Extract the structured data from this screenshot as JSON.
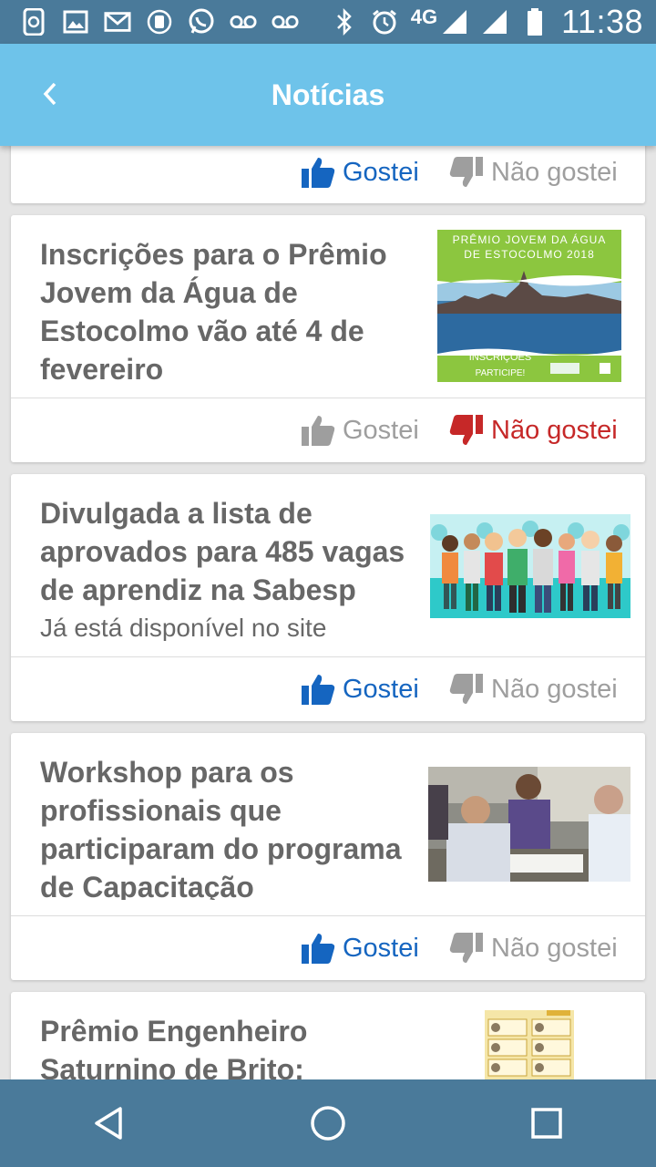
{
  "status_bar": {
    "network": "4G",
    "time": "11:38",
    "icons": [
      "device-sync-icon",
      "image-icon",
      "mail-icon",
      "app-update-icon",
      "whatsapp-icon",
      "voicemail-icon",
      "voicemail-icon",
      "bluetooth-icon",
      "alarm-icon",
      "signal-icon",
      "signal-icon",
      "battery-icon"
    ]
  },
  "app_bar": {
    "title": "Notícias",
    "back_icon": "chevron-left-icon"
  },
  "actions": {
    "like_label": "Gostei",
    "dislike_label": "Não gostei"
  },
  "articles": [
    {
      "title": "",
      "like_active": true,
      "dislike_active": false
    },
    {
      "title": "Inscrições para o Prêmio Jovem da Água de Estocolmo vão até 4 de fevereiro",
      "image_text": [
        "PRÊMIO JOVEM DA ÁGUA",
        "DE ESTOCOLMO 2018",
        "INSCRIÇÕES",
        "PARTICIPE!"
      ],
      "like_active": false,
      "dislike_active": true
    },
    {
      "title": "Divulgada a lista de aprovados para 485 vagas de aprendiz na Sabesp",
      "subtitle": "Já está disponível no site",
      "like_active": true,
      "dislike_active": false
    },
    {
      "title": "Workshop para os profissionais que participaram do programa de Capacitação",
      "like_active": true,
      "dislike_active": false
    },
    {
      "title": "Prêmio Engenheiro Saturnino de Brito:"
    }
  ],
  "colors": {
    "app_bar": "#6ec3ea",
    "system_bars": "#4a7a9a",
    "like_active": "#1565c0",
    "dislike_active": "#c62828",
    "inactive": "#9e9e9e"
  }
}
